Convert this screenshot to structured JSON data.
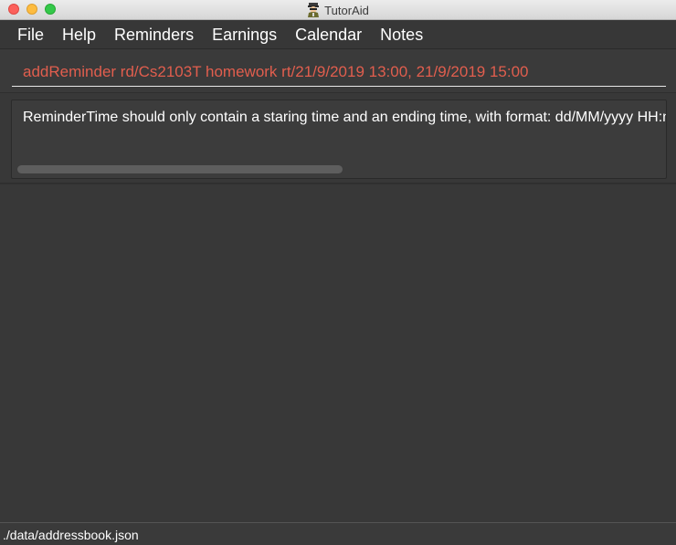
{
  "window": {
    "title": "TutorAid",
    "app_icon": "tutor-avatar-icon"
  },
  "menu": {
    "items": [
      {
        "label": "File"
      },
      {
        "label": "Help"
      },
      {
        "label": "Reminders"
      },
      {
        "label": "Earnings"
      },
      {
        "label": "Calendar"
      },
      {
        "label": "Notes"
      }
    ]
  },
  "command": {
    "value": "addReminder rd/Cs2103T homework rt/21/9/2019 13:00, 21/9/2019 15:00",
    "text_color": "#e15e4e"
  },
  "result": {
    "message": "ReminderTime should only contain a staring time and an ending time, with format: dd/MM/yyyy HH:mm, dd/MM/yyyy HH:mm"
  },
  "status": {
    "file_path": "./data/addressbook.json"
  },
  "colors": {
    "background": "#383838",
    "menu_text": "#ffffff",
    "error_text": "#e15e4e"
  }
}
